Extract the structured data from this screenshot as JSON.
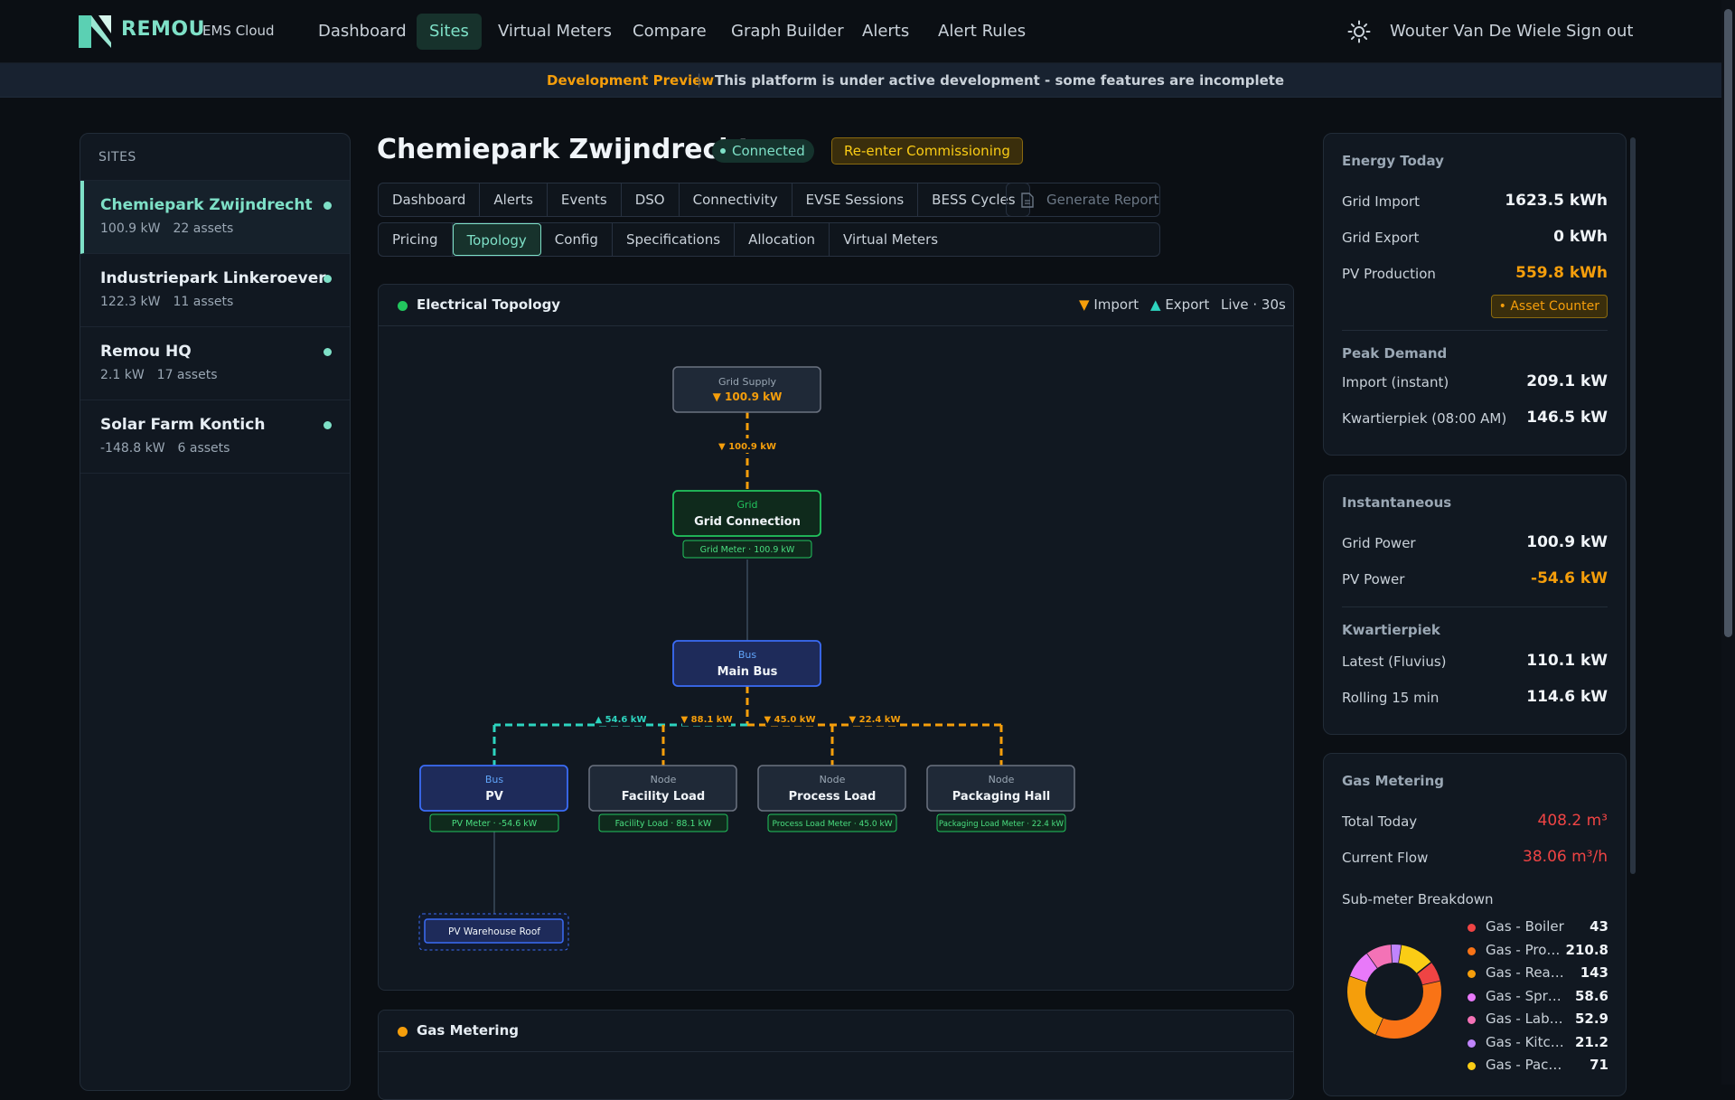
{
  "brand": {
    "name": "REMOU",
    "sub": "EMS Cloud"
  },
  "nav": {
    "items": [
      "Dashboard",
      "Sites",
      "Virtual Meters",
      "Compare",
      "Graph Builder",
      "Alerts",
      "Alert Rules"
    ],
    "active": "Sites",
    "user": "Wouter Van De Wiele",
    "signout": "Sign out"
  },
  "banner": {
    "tag": "Development Preview",
    "message": "This platform is under active development - some features are incomplete"
  },
  "sidebar": {
    "header": "SITES",
    "sites": [
      {
        "name": "Chemiepark Zwijndrecht",
        "power": "100.9 kW",
        "assets": "22 assets",
        "active": true
      },
      {
        "name": "Industriepark Linkeroever",
        "power": "122.3 kW",
        "assets": "11 assets",
        "active": false
      },
      {
        "name": "Remou HQ",
        "power": "2.1 kW",
        "assets": "17 assets",
        "active": false
      },
      {
        "name": "Solar Farm Kontich",
        "power": "-148.8 kW",
        "assets": "6 assets",
        "active": false
      }
    ]
  },
  "page": {
    "title": "Chemiepark Zwijndrecht",
    "status": "Connected",
    "commission_button": "Re-enter Commissioning",
    "tabs_row1": [
      "Dashboard",
      "Alerts",
      "Events",
      "DSO",
      "Connectivity",
      "EVSE Sessions",
      "BESS Cycles"
    ],
    "tabs_row2": [
      "Pricing",
      "Topology",
      "Config",
      "Specifications",
      "Allocation",
      "Virtual Meters"
    ],
    "active_tab": "Topology",
    "report_button": "Generate Report"
  },
  "topology": {
    "title": "Electrical Topology",
    "legend": {
      "import": "Import",
      "export": "Export",
      "live": "Live · 30s"
    },
    "grid_supply": {
      "label": "Grid Supply",
      "value": "▼ 100.9 kW"
    },
    "supply_flow": "▼ 100.9 kW",
    "grid": {
      "type": "Grid",
      "name": "Grid Connection",
      "meter": "Grid Meter · 100.9 kW"
    },
    "main_bus": {
      "type": "Bus",
      "name": "Main Bus"
    },
    "branch_flows": [
      "▲ 54.6 kW",
      "▼ 88.1 kW",
      "▼ 45.0 kW",
      "▼ 22.4 kW"
    ],
    "children": [
      {
        "type": "Bus",
        "name": "PV",
        "meter": "PV Meter · -54.6 kW"
      },
      {
        "type": "Node",
        "name": "Facility Load",
        "meter": "Facility Load · 88.1 kW"
      },
      {
        "type": "Node",
        "name": "Process Load",
        "meter": "Process Load Meter · 45.0 kW"
      },
      {
        "type": "Node",
        "name": "Packaging Hall",
        "meter": "Packaging Load Meter · 22.4 kW"
      }
    ],
    "pv_asset": "PV Warehouse Roof"
  },
  "gas_panel": {
    "title": "Gas Metering"
  },
  "energy_today": {
    "title": "Energy Today",
    "grid_import_label": "Grid Import",
    "grid_import": "1623.5 kWh",
    "grid_export_label": "Grid Export",
    "grid_export": "0 kWh",
    "pv_label": "PV Production",
    "pv": "559.8 kWh",
    "asset_counter": "• Asset Counter",
    "peak_title": "Peak Demand",
    "import_instant_label": "Import (instant)",
    "import_instant": "209.1 kW",
    "kwartierpiek_label": "Kwartierpiek (08:00 AM)",
    "kwartierpiek": "146.5 kW"
  },
  "instantaneous": {
    "title": "Instantaneous",
    "grid_power_label": "Grid Power",
    "grid_power": "100.9 kW",
    "pv_power_label": "PV Power",
    "pv_power": "-54.6 kW",
    "kwartierpiek_title": "Kwartierpiek",
    "latest_label": "Latest (Fluvius)",
    "latest": "110.1 kW",
    "rolling_label": "Rolling 15 min",
    "rolling": "114.6 kW"
  },
  "gas_metering": {
    "title": "Gas Metering",
    "total_label": "Total Today",
    "total": "408.2 m³",
    "flow_label": "Current Flow",
    "flow": "38.06 m³/h",
    "breakdown_title": "Sub-meter Breakdown",
    "submeters": [
      {
        "name": "Gas - Boiler",
        "value": 43,
        "color": "#ef4444"
      },
      {
        "name": "Gas - Process",
        "value": 210.8,
        "color": "#f97316"
      },
      {
        "name": "Gas - Reactor",
        "value": 143,
        "color": "#f59e0b"
      },
      {
        "name": "Gas - Spray Dryer",
        "value": 58.6,
        "color": "#e879f9"
      },
      {
        "name": "Gas - Laboratory",
        "value": 52.9,
        "color": "#f472b6"
      },
      {
        "name": "Gas - Kitchen",
        "value": 21.2,
        "color": "#c084fc"
      },
      {
        "name": "Gas - Packaging",
        "value": 71,
        "color": "#facc15"
      }
    ]
  },
  "colors": {
    "accent": "#7ee0c7",
    "import": "#f59e0b",
    "export": "#2dd4bf",
    "background": "#0b0f14"
  }
}
